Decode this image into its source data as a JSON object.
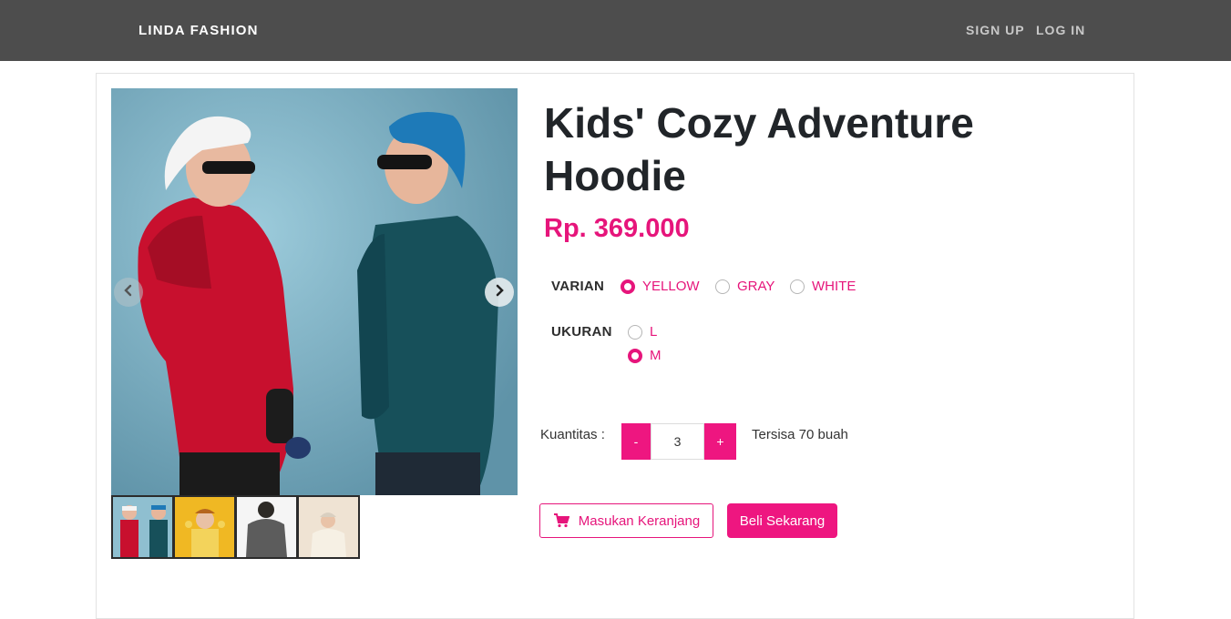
{
  "header": {
    "brand": "LINDA FASHION",
    "sign_up": "SIGN UP",
    "log_in": "LOG IN"
  },
  "product": {
    "title": "Kids' Cozy Adventure Hoodie",
    "price": "Rp. 369.000",
    "variant_label": "VARIAN",
    "variants": [
      {
        "label": "YELLOW",
        "selected": true
      },
      {
        "label": "GRAY",
        "selected": false
      },
      {
        "label": "WHITE",
        "selected": false
      }
    ],
    "size_label": "UKURAN",
    "sizes": [
      {
        "label": "L",
        "selected": false
      },
      {
        "label": "M",
        "selected": true
      }
    ],
    "quantity_label": "Kuantitas :",
    "quantity_value": "3",
    "minus_label": "-",
    "plus_label": "+",
    "stock_text": "Tersisa 70 buah",
    "add_to_cart_label": "Masukan Keranjang",
    "buy_now_label": "Beli Sekarang"
  },
  "gallery": {
    "active_index": 0,
    "thumbnails": [
      "two-boys-hoodies",
      "girl-yellow-hoodie",
      "gray-hoodie-back",
      "kid-cream-hoodie"
    ]
  },
  "icons": {
    "prev": "chevron-left-icon",
    "next": "chevron-right-icon",
    "cart": "cart-icon"
  },
  "colors": {
    "accent": "#e6157b",
    "header_bg": "#4d4d4d",
    "image_bg": "#6fa4b9"
  }
}
